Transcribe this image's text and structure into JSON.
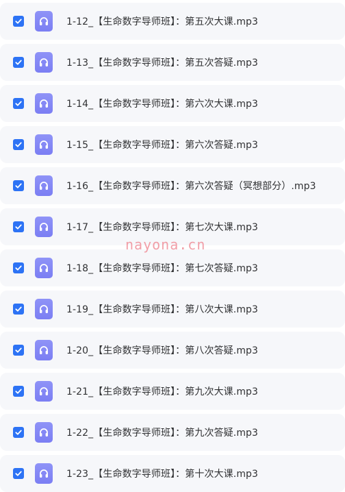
{
  "accent_color": "#2d73f5",
  "icon_color": "#7b7ef3",
  "files": [
    {
      "checked": true,
      "icon": "headphones-icon",
      "name": "1-12_【生命数字导师班】：第五次大课.mp3"
    },
    {
      "checked": true,
      "icon": "headphones-icon",
      "name": "1-13_【生命数字导师班】：第五次答疑.mp3"
    },
    {
      "checked": true,
      "icon": "headphones-icon",
      "name": "1-14_【生命数字导师班】：第六次大课.mp3"
    },
    {
      "checked": true,
      "icon": "headphones-icon",
      "name": "1-15_【生命数字导师班】：第六次答疑.mp3"
    },
    {
      "checked": true,
      "icon": "headphones-icon",
      "name": "1-16_【生命数字导师班】：第六次答疑（冥想部分）.mp3"
    },
    {
      "checked": true,
      "icon": "headphones-icon",
      "name": "1-17_【生命数字导师班】：第七次大课.mp3"
    },
    {
      "checked": true,
      "icon": "headphones-icon",
      "name": "1-18_【生命数字导师班】：第七次答疑.mp3"
    },
    {
      "checked": true,
      "icon": "headphones-icon",
      "name": "1-19_【生命数字导师班】：第八次大课.mp3"
    },
    {
      "checked": true,
      "icon": "headphones-icon",
      "name": "1-20_【生命数字导师班】：第八次答疑.mp3"
    },
    {
      "checked": true,
      "icon": "headphones-icon",
      "name": "1-21_【生命数字导师班】：第九次大课.mp3"
    },
    {
      "checked": true,
      "icon": "headphones-icon",
      "name": "1-22_【生命数字导师班】：第九次答疑.mp3"
    },
    {
      "checked": true,
      "icon": "headphones-icon",
      "name": "1-23_【生命数字导师班】：第十次大课.mp3"
    }
  ],
  "watermark": "nayona.cn"
}
